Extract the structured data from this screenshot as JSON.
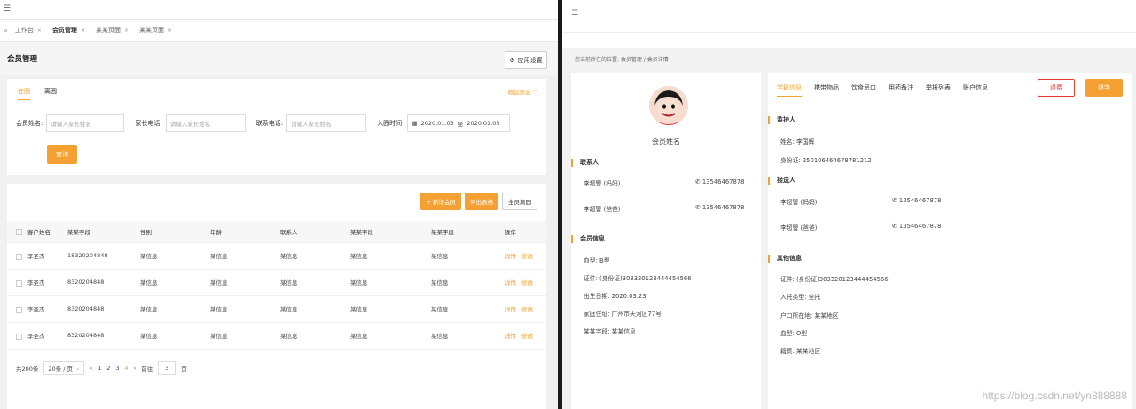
{
  "left": {
    "tabs": {
      "home": "工作台",
      "active": "会员管理",
      "t3": "某某页面",
      "t4": "某某页面"
    },
    "page_title": "会员管理",
    "settings_label": "应用设置",
    "filter": {
      "tab_in": "在园",
      "tab_out": "离园",
      "collapse": "收起筛选 ^",
      "name_label": "会员姓名:",
      "name_placeholder": "请输入家长姓名",
      "parent_phone_label": "家长电话:",
      "parent_phone_placeholder": "请输入家长姓名",
      "contact_label": "联系电话:",
      "contact_placeholder": "请输入家长姓名",
      "date_label": "入园时间:",
      "date_from": "2020.01.03",
      "date_sep": "至",
      "date_to": "2020.01.03",
      "query": "查询"
    },
    "toolbar": {
      "add": "+ 新增会员",
      "export": "导出表格",
      "all_out": "全员离园"
    },
    "table": {
      "headers": [
        "客户姓名",
        "某某字段",
        "性别",
        "年龄",
        "联系人",
        "某某字段",
        "某某字段",
        "操作"
      ],
      "rows": [
        [
          "李圣杰",
          "18320204848",
          "某信息",
          "某信息",
          "某信息",
          "某信息",
          "某信息"
        ],
        [
          "李圣杰",
          "8320204848",
          "某信息",
          "某信息",
          "某信息",
          "某信息",
          "某信息"
        ],
        [
          "李圣杰",
          "8320204848",
          "某信息",
          "某信息",
          "某信息",
          "某信息",
          "某信息"
        ],
        [
          "李圣杰",
          "8320204848",
          "某信息",
          "某信息",
          "某信息",
          "某信息",
          "某信息"
        ]
      ],
      "detail": "详情",
      "edit": "修改"
    },
    "pager": {
      "total": "共200条",
      "size": "20条 / 页",
      "prev": "‹",
      "p1": "1",
      "p2": "2",
      "p3": "3",
      "p4": "4",
      "next": "›",
      "goto": "前往",
      "goto_val": "3",
      "page": "页"
    }
  },
  "right": {
    "breadcrumb": "您当前所在的位置: 会员管理 / 会员详情",
    "member_name": "会员姓名",
    "contact_title": "联系人",
    "contacts": [
      {
        "name": "李超警 (妈妈)",
        "phone": "13546467878"
      },
      {
        "name": "李超警 (爸爸)",
        "phone": "13546467878"
      }
    ],
    "info_title": "会员信息",
    "info": [
      "血型: B型",
      "证件: (身份证)303320123444454566",
      "出生日期: 2020.03.23",
      "家庭住址: 广州市天河区77号",
      "某某字段: 某某信息"
    ],
    "tabs": [
      "学籍信息",
      "携带物品",
      "饮食忌口",
      "用药备注",
      "举报列表",
      "账户信息"
    ],
    "btn_withdraw": "退费",
    "btn_leave": "退学",
    "guardian_title": "监护人",
    "guardian": [
      "姓名: 李国辉",
      "身份证: 250106464678781212"
    ],
    "pickup_title": "接送人",
    "pickups": [
      {
        "name": "李超警 (妈妈)",
        "phone": "13546467878"
      },
      {
        "name": "李超警 (爸爸)",
        "phone": "13546467878"
      }
    ],
    "other_title": "其他信息",
    "other": [
      "证件: (身份证)303320123444454566",
      "入托类型: 全托",
      "户口所在地: 某某地区",
      "血型: O型",
      "籍贯: 某某地区"
    ],
    "watermark": "https://blog.csdn.net/yn888888"
  }
}
